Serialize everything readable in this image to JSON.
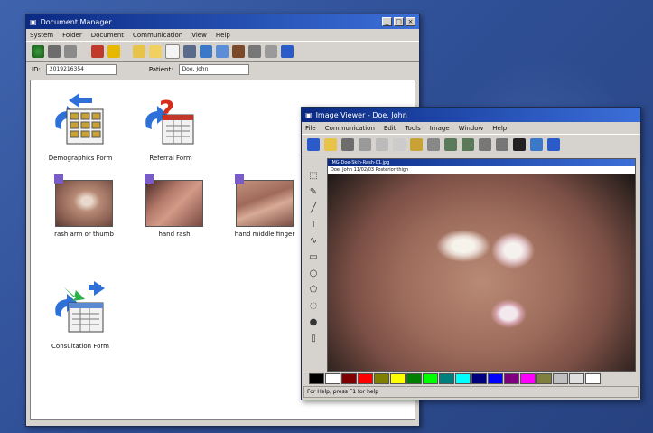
{
  "doc_window": {
    "title": "Document Manager",
    "menu": [
      "System",
      "Folder",
      "Document",
      "Communication",
      "View",
      "Help"
    ],
    "id_label": "ID:",
    "id_value": "2019216354",
    "patient_label": "Patient:",
    "patient_value": "Doe, John",
    "items": [
      {
        "label": "Demographics Form",
        "icon": "demographics-form-icon"
      },
      {
        "label": "Referral Form",
        "icon": "referral-form-icon"
      },
      {
        "label": "rash arm or thumb",
        "icon": "photo-thumbnail"
      },
      {
        "label": "hand rash",
        "icon": "photo-thumbnail"
      },
      {
        "label": "hand middle finger",
        "icon": "photo-thumbnail"
      },
      {
        "label": "Consultation Form",
        "icon": "consultation-form-icon"
      }
    ]
  },
  "img_window": {
    "title": "Image Viewer - Doe, John",
    "menu": [
      "File",
      "Communication",
      "Edit",
      "Tools",
      "Image",
      "Window",
      "Help"
    ],
    "image_title": "IMG-Doe-Skin-Rash-01.jpg",
    "image_caption": "Doe, John 11/02/03 Posterior thigh",
    "status": "For Help, press F1 for help",
    "palette": [
      "#000000",
      "#ffffff",
      "#7f0000",
      "#ff0000",
      "#7f7f00",
      "#ffff00",
      "#007f00",
      "#00ff00",
      "#007f7f",
      "#00ffff",
      "#00007f",
      "#0000ff",
      "#7f007f",
      "#ff00ff",
      "#7f7f3f",
      "#c0c0c0",
      "#e0e0e0",
      "#ffffff"
    ]
  },
  "colors": {
    "desktop": "#2f4f96",
    "titlebar": "#0a2a83",
    "chrome": "#d6d3ce"
  }
}
